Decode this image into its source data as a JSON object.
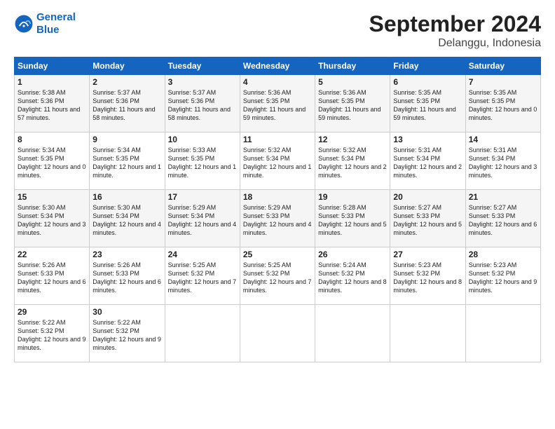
{
  "logo": {
    "line1": "General",
    "line2": "Blue"
  },
  "title": "September 2024",
  "location": "Delanggu, Indonesia",
  "days_of_week": [
    "Sunday",
    "Monday",
    "Tuesday",
    "Wednesday",
    "Thursday",
    "Friday",
    "Saturday"
  ],
  "weeks": [
    [
      {
        "day": "1",
        "sunrise": "5:38 AM",
        "sunset": "5:36 PM",
        "daylight": "11 hours and 57 minutes."
      },
      {
        "day": "2",
        "sunrise": "5:37 AM",
        "sunset": "5:36 PM",
        "daylight": "11 hours and 58 minutes."
      },
      {
        "day": "3",
        "sunrise": "5:37 AM",
        "sunset": "5:36 PM",
        "daylight": "11 hours and 58 minutes."
      },
      {
        "day": "4",
        "sunrise": "5:36 AM",
        "sunset": "5:35 PM",
        "daylight": "11 hours and 59 minutes."
      },
      {
        "day": "5",
        "sunrise": "5:36 AM",
        "sunset": "5:35 PM",
        "daylight": "11 hours and 59 minutes."
      },
      {
        "day": "6",
        "sunrise": "5:35 AM",
        "sunset": "5:35 PM",
        "daylight": "11 hours and 59 minutes."
      },
      {
        "day": "7",
        "sunrise": "5:35 AM",
        "sunset": "5:35 PM",
        "daylight": "12 hours and 0 minutes."
      }
    ],
    [
      {
        "day": "8",
        "sunrise": "5:34 AM",
        "sunset": "5:35 PM",
        "daylight": "12 hours and 0 minutes."
      },
      {
        "day": "9",
        "sunrise": "5:34 AM",
        "sunset": "5:35 PM",
        "daylight": "12 hours and 1 minute."
      },
      {
        "day": "10",
        "sunrise": "5:33 AM",
        "sunset": "5:35 PM",
        "daylight": "12 hours and 1 minute."
      },
      {
        "day": "11",
        "sunrise": "5:32 AM",
        "sunset": "5:34 PM",
        "daylight": "12 hours and 1 minute."
      },
      {
        "day": "12",
        "sunrise": "5:32 AM",
        "sunset": "5:34 PM",
        "daylight": "12 hours and 2 minutes."
      },
      {
        "day": "13",
        "sunrise": "5:31 AM",
        "sunset": "5:34 PM",
        "daylight": "12 hours and 2 minutes."
      },
      {
        "day": "14",
        "sunrise": "5:31 AM",
        "sunset": "5:34 PM",
        "daylight": "12 hours and 3 minutes."
      }
    ],
    [
      {
        "day": "15",
        "sunrise": "5:30 AM",
        "sunset": "5:34 PM",
        "daylight": "12 hours and 3 minutes."
      },
      {
        "day": "16",
        "sunrise": "5:30 AM",
        "sunset": "5:34 PM",
        "daylight": "12 hours and 4 minutes."
      },
      {
        "day": "17",
        "sunrise": "5:29 AM",
        "sunset": "5:34 PM",
        "daylight": "12 hours and 4 minutes."
      },
      {
        "day": "18",
        "sunrise": "5:29 AM",
        "sunset": "5:33 PM",
        "daylight": "12 hours and 4 minutes."
      },
      {
        "day": "19",
        "sunrise": "5:28 AM",
        "sunset": "5:33 PM",
        "daylight": "12 hours and 5 minutes."
      },
      {
        "day": "20",
        "sunrise": "5:27 AM",
        "sunset": "5:33 PM",
        "daylight": "12 hours and 5 minutes."
      },
      {
        "day": "21",
        "sunrise": "5:27 AM",
        "sunset": "5:33 PM",
        "daylight": "12 hours and 6 minutes."
      }
    ],
    [
      {
        "day": "22",
        "sunrise": "5:26 AM",
        "sunset": "5:33 PM",
        "daylight": "12 hours and 6 minutes."
      },
      {
        "day": "23",
        "sunrise": "5:26 AM",
        "sunset": "5:33 PM",
        "daylight": "12 hours and 6 minutes."
      },
      {
        "day": "24",
        "sunrise": "5:25 AM",
        "sunset": "5:32 PM",
        "daylight": "12 hours and 7 minutes."
      },
      {
        "day": "25",
        "sunrise": "5:25 AM",
        "sunset": "5:32 PM",
        "daylight": "12 hours and 7 minutes."
      },
      {
        "day": "26",
        "sunrise": "5:24 AM",
        "sunset": "5:32 PM",
        "daylight": "12 hours and 8 minutes."
      },
      {
        "day": "27",
        "sunrise": "5:23 AM",
        "sunset": "5:32 PM",
        "daylight": "12 hours and 8 minutes."
      },
      {
        "day": "28",
        "sunrise": "5:23 AM",
        "sunset": "5:32 PM",
        "daylight": "12 hours and 9 minutes."
      }
    ],
    [
      {
        "day": "29",
        "sunrise": "5:22 AM",
        "sunset": "5:32 PM",
        "daylight": "12 hours and 9 minutes."
      },
      {
        "day": "30",
        "sunrise": "5:22 AM",
        "sunset": "5:32 PM",
        "daylight": "12 hours and 9 minutes."
      },
      null,
      null,
      null,
      null,
      null
    ]
  ],
  "labels": {
    "sunrise": "Sunrise:",
    "sunset": "Sunset:",
    "daylight": "Daylight:"
  }
}
